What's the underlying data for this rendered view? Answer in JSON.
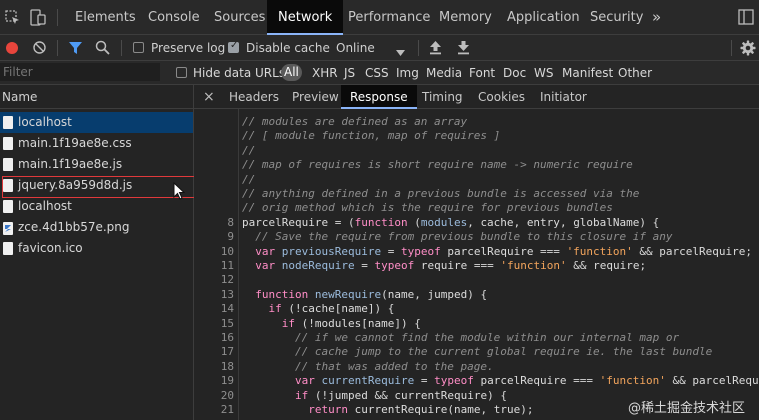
{
  "tabs": [
    "Elements",
    "Console",
    "Sources",
    "Network",
    "Performance",
    "Memory",
    "Application",
    "Security"
  ],
  "more_tabs": "»",
  "toolbar": {
    "preserve_log": "Preserve log",
    "preserve_log_checked": false,
    "disable_cache": "Disable cache",
    "disable_cache_checked": true,
    "throttling": "Online"
  },
  "filter": {
    "placeholder": "Filter",
    "hide_data_urls": "Hide data URLs",
    "types": [
      "All",
      "XHR",
      "JS",
      "CSS",
      "Img",
      "Media",
      "Font",
      "Doc",
      "WS",
      "Manifest",
      "Other"
    ]
  },
  "requests": {
    "header": "Name",
    "items": [
      "localhost",
      "main.1f19ae8e.css",
      "main.1f19ae8e.js",
      "jquery.8a959d8d.js",
      "localhost",
      "zce.4d1bb57e.png",
      "favicon.ico"
    ]
  },
  "detail_tabs": [
    "Headers",
    "Preview",
    "Response",
    "Timing",
    "Cookies",
    "Initiator"
  ],
  "active_detail_tab": "Response",
  "close_symbol": "×",
  "code": [
    {
      "n": "",
      "t": "// modules are defined as an array"
    },
    {
      "n": "",
      "t": "// [ module function, map of requires ]"
    },
    {
      "n": "",
      "t": "//"
    },
    {
      "n": "",
      "t": "// map of requires is short require name -> numeric require"
    },
    {
      "n": "",
      "t": "//"
    },
    {
      "n": "",
      "t": "// anything defined in a previous bundle is accessed via the"
    },
    {
      "n": "",
      "t": "// orig method which is the require for previous bundles"
    },
    {
      "n": "8",
      "t": "parcelRequire = (function (modules, cache, entry, globalName) {"
    },
    {
      "n": "9",
      "t": "  // Save the require from previous bundle to this closure if any"
    },
    {
      "n": "10",
      "t": "  var previousRequire = typeof parcelRequire === 'function' && parcelRequire;"
    },
    {
      "n": "11",
      "t": "  var nodeRequire = typeof require === 'function' && require;"
    },
    {
      "n": "12",
      "t": ""
    },
    {
      "n": "13",
      "t": "  function newRequire(name, jumped) {"
    },
    {
      "n": "14",
      "t": "    if (!cache[name]) {"
    },
    {
      "n": "15",
      "t": "      if (!modules[name]) {"
    },
    {
      "n": "16",
      "t": "        // if we cannot find the module within our internal map or"
    },
    {
      "n": "17",
      "t": "        // cache jump to the current global require ie. the last bundle"
    },
    {
      "n": "18",
      "t": "        // that was added to the page."
    },
    {
      "n": "19",
      "t": "        var currentRequire = typeof parcelRequire === 'function' && parcelRequire;"
    },
    {
      "n": "20",
      "t": "        if (!jumped && currentRequire) {"
    },
    {
      "n": "21",
      "t": "          return currentRequire(name, true);"
    }
  ],
  "watermark": "@稀土掘金技术社区",
  "colors": {
    "accent_blue": "#8ab4f8",
    "record_red": "#e8453c",
    "selected_row": "#073d6e",
    "highlight_outline": "#e0393b",
    "comment": "#8e8e8e",
    "keyword": "#ff8ec7",
    "string": "#f2a45c",
    "identifier": "#9bbbdc"
  },
  "icons": {
    "inspect": "inspect-element-icon",
    "device": "device-toolbar-icon",
    "record": "record-icon",
    "clear": "clear-icon",
    "filter": "filter-funnel-icon",
    "search": "search-icon",
    "import": "import-har-icon",
    "export": "export-har-icon",
    "settings": "gear-icon",
    "cursor": "mouse-pointer-icon",
    "file": "file-icon",
    "image": "image-file-icon"
  }
}
